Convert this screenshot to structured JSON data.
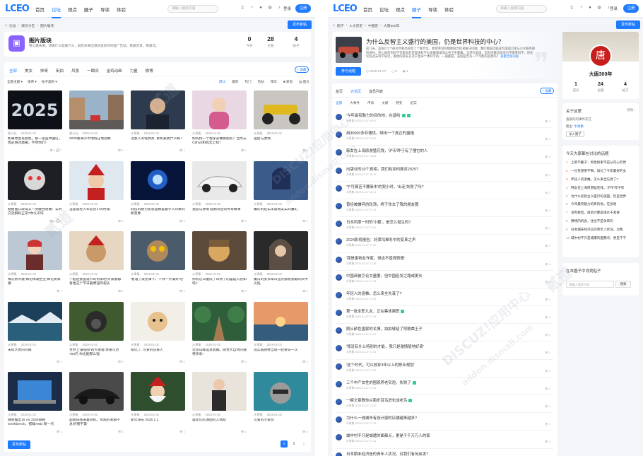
{
  "left": {
    "logo": "LCEO",
    "nav": [
      {
        "label": "首页",
        "active": false
      },
      {
        "label": "论坛",
        "active": true
      },
      {
        "label": "观点",
        "active": false
      },
      {
        "label": "圈子",
        "active": false
      },
      {
        "label": "导读",
        "active": false
      },
      {
        "label": "体验",
        "active": false
      }
    ],
    "search_placeholder": "请输入搜索内容",
    "login": "登录",
    "register": "注册",
    "breadcrumb": [
      "论坛",
      "演示分区",
      "图片版块"
    ],
    "new_post": "发布新帖",
    "forum": {
      "name": "图片版块",
      "desc": "用心赢未来。想做什么就做什么，鼓足未来出道就是你的地盘广告站，看最创意，看最流。",
      "stats": [
        {
          "value": "0",
          "label": "今日"
        },
        {
          "value": "28",
          "label": "主题"
        },
        {
          "value": "4",
          "label": "帖子"
        }
      ]
    },
    "tabs": [
      "全部",
      "美女",
      "帅哥",
      "街拍",
      "风景",
      "一瞬间",
      "金鸡动画",
      "力量",
      "微博"
    ],
    "collect": "+ 收藏",
    "filters": [
      "全部主题 ▾",
      "排序 ▾",
      "帖子类别 ▾"
    ],
    "sorts": [
      {
        "label": "默认",
        "active": true
      },
      {
        "label": "最新",
        "active": false
      },
      {
        "label": "热门",
        "active": false
      },
      {
        "label": "热帖",
        "active": false
      },
      {
        "label": "精华",
        "active": false
      },
      {
        "label": "■ 新窗",
        "active": false
      },
      {
        "label": "▤ 图文",
        "active": false
      }
    ],
    "gallery": [
      {
        "title": "如果你因有颜色，那一定是中国红，我必将对敲被，不然你们！",
        "author": "湘公社",
        "date": "2025-01-02",
        "stats": "👁 1  💬 1",
        "icon": "text-2025-dark"
      },
      {
        "title": "2025春海沙市地域在地观察",
        "author": "湘公社",
        "date": "2025-01-02",
        "stats": "👁 1",
        "icon": "city-street"
      },
      {
        "title": "注意人的经费高, 食和美我什么概？",
        "author": "水果集",
        "date": "2025-01-02",
        "stats": "👁 1",
        "icon": "man-portrait"
      },
      {
        "title": "如何找一个程序员做男朋友？当然去Github和码云上找！",
        "author": "水果集",
        "date": "2025-01-02",
        "stats": "👁 1",
        "icon": "woman-portrait"
      },
      {
        "title": "速度与激情",
        "author": "水果集",
        "date": "2025-01-02",
        "stats": "👁 1",
        "icon": "motorbike"
      },
      {
        "title": "骷髅面口取得又一突破性进展：实时交流解码正常?你认识吗",
        "author": "水果集",
        "date": "2025-01-02",
        "stats": "👁 1  💬 1",
        "icon": "skull-robot"
      },
      {
        "title": "当圣诞老人年纪历小的时候",
        "author": "水果集",
        "date": "2025-01-02",
        "stats": "👁 1",
        "icon": "santa-kid"
      },
      {
        "title": "科技的魅力总总是数是最令人印象的新景象",
        "author": "水果集",
        "date": "2025-01-02",
        "stats": "👁 1",
        "icon": "bulb-energy"
      },
      {
        "title": "速度与激情 超跑背后的传奇故事",
        "author": "水果集",
        "date": "2025-01-02",
        "stats": "👁 1",
        "icon": "sports-car"
      },
      {
        "title": "魔幻的纪实未容而实实的魔幻",
        "author": "水果集",
        "date": "2025-01-02",
        "stats": "👁 1",
        "icon": "anime-girl"
      },
      {
        "title": "梅花依大廈,梅花梅潮生业,梅花要离歌",
        "author": "水果集",
        "date": "2025-01-02",
        "stats": "👁 1",
        "icon": "winter-girl"
      },
      {
        "title": "一起迎接圣诞节的到来吧!大家都都有给这个节日最便道的祝乐",
        "author": "水果集",
        "date": "2025-01-02",
        "stats": "👁 1",
        "icon": "dog-santa"
      },
      {
        "title": "'看准了就把事干，干你一片美好'吧",
        "author": "水果集",
        "date": "2025-01-02",
        "stats": "👁 1",
        "icon": "owl-cat"
      },
      {
        "title": "你有这么酷炫了吗你了的猫是人族如吗?",
        "author": "水果集",
        "date": "2025-01-02",
        "stats": "👁 1",
        "icon": "cat-helmet"
      },
      {
        "title": "魔法的女孩早日显光都我我眼的风中火焰",
        "author": "水果集",
        "date": "2025-01-02",
        "stats": "👁 1",
        "icon": "hooded-girl"
      },
      {
        "title": "未似大觉的间候",
        "author": "水果集",
        "date": "2025-01-02",
        "stats": "👁 1",
        "icon": "lake-ice"
      },
      {
        "title": "世界上'最强悍'的大猩猩,体重可达700斤,你也能那么强",
        "author": "水果集",
        "date": "2025-01-02",
        "stats": "👁 1",
        "icon": "gorilla"
      },
      {
        "title": "萌化了, 可爱的狂暴人",
        "author": "水果集",
        "date": "2025-01-02",
        "stats": "👁 1",
        "icon": "puppy"
      },
      {
        "title": "近景山峰选景妩媚。感觉大自然的独特多彩!",
        "author": "水果集",
        "date": "2025-01-02",
        "stats": "👁 1",
        "icon": "forest-path"
      },
      {
        "title": "现实般感野当就一趁要去一次",
        "author": "水果集",
        "date": "2025-01-02",
        "stats": "👁 1",
        "icon": "lake-sunset"
      },
      {
        "title": "微星推出16 Air 2025规格 Geekbench，搭载AMD 新一代",
        "author": "水果集",
        "date": "2025-01-02",
        "stats": "👁 1",
        "icon": "laptop"
      },
      {
        "title": "超跑阵线来曼目标。零跑的底稿不总'好而不美'",
        "author": "水果集",
        "date": "2025-01-02",
        "stats": "👁 1",
        "icon": "black-car"
      },
      {
        "title": "新年快乐 2025 1.1",
        "author": "水果集",
        "date": "2025-01-02",
        "stats": "👁 1",
        "icon": "santa-old"
      },
      {
        "title": "美女们的演困的人情结",
        "author": "水果集",
        "date": "2025-01-02",
        "stats": "👁 1",
        "icon": "girl-coat"
      },
      {
        "title": "可爱的小家伙",
        "author": "水果集",
        "date": "2025-01-02",
        "stats": "👁 2",
        "icon": "raccoon"
      }
    ],
    "pager": [
      "1",
      "2",
      "›"
    ],
    "bottom_post": "发布新帖"
  },
  "right": {
    "logo": "LCEO",
    "nav": [
      {
        "label": "首页",
        "active": false
      },
      {
        "label": "论坛",
        "active": false
      },
      {
        "label": "观点",
        "active": false
      },
      {
        "label": "圈子",
        "active": true
      },
      {
        "label": "导读",
        "active": false
      },
      {
        "label": "体验",
        "active": false
      }
    ],
    "search_placeholder": "请输入搜索内容",
    "login": "登录",
    "register": "注册",
    "breadcrumb": [
      "圈子",
      "人文历史",
      "中国史",
      "大唐300年"
    ],
    "new_post": "发布新帖",
    "post": {
      "title": "为什么反智主义盛行的美国，仍是世界科技的中心？",
      "desc": "前几天，美国172个研究所和高校签了个联合信，希望参议院能能联合起来解决问题，我们能很迅猛成为美国卫生与公众服务部的部长，担心他的伪科学可能会危害美国科学与发展和美国公共卫生健康。当然在美国，因为宗教信仰成为不接受科学，进化论及过去科学研究，看他的部长在对于生命个体科学的，一般都是，美国是否有一个可能的答案吗？",
      "more": "查看全部内容",
      "join": "参与话题",
      "date": "2025-01-07",
      "replies": "0",
      "views": "1"
    },
    "list_tabs": [
      {
        "label": "首页",
        "active": false
      },
      {
        "label": "讨论区",
        "active": true
      },
      {
        "label": "成员列表",
        "active": false
      }
    ],
    "collect": "+ 收藏",
    "sub_tabs": [
      {
        "label": "全部",
        "active": true
      },
      {
        "label": "大事件",
        "active": false
      },
      {
        "label": "传承",
        "active": false
      },
      {
        "label": "文献",
        "active": false
      },
      {
        "label": "野史",
        "active": false
      },
      {
        "label": "纪实",
        "active": false
      }
    ],
    "threads": [
      {
        "title": "'今年最有魅力的目的地，在昌哈",
        "meta": "水果集  2025-01-07 18:57",
        "stats": "👁 2",
        "tags": [
          "#3c9",
          "#3c9"
        ]
      },
      {
        "title": "用35000多亚德供，绑出一个真正的露帽",
        "meta": "水果集  2025-01-07 18:40",
        "stats": "👁 1",
        "tags": []
      },
      {
        "title": "韩女在上海原游猛花钱，'沪币'昨于有了懂它的人",
        "meta": "水果集  2025-01-07 18:28",
        "stats": "👁 4",
        "tags": []
      },
      {
        "title": "出版业的10个真相，我们有如何面对2025?",
        "meta": "水果集  2025-01-07 18:12",
        "stats": "👁 1",
        "tags": []
      },
      {
        "title": "'宁可痛苦不要麻木'的契小时，'出走'失败了吗?",
        "meta": "水果集  2025-01-07 18:10",
        "stats": "👁 1",
        "tags": []
      },
      {
        "title": "曾经被嫌弃的轮滑，终于攻去了我的朋友圈",
        "meta": "水果集  2025-01-07 17:41",
        "stats": "👁 1",
        "tags": []
      },
      {
        "title": "日本风靡一时的'小额'，是怎么诞生的?",
        "meta": "水果集  2025-01-07 17:40",
        "stats": "👁 1",
        "tags": []
      },
      {
        "title": "2024影视报告：好莱坞难冬中的变革之声",
        "meta": "水果集  2025-01-07 17:37",
        "stats": "👁 1",
        "tags": []
      },
      {
        "title": "'我是废物女作家，但这不值得骄傲'",
        "meta": "水果集  2025-01-07 17:35",
        "stats": "👁 1",
        "tags": []
      },
      {
        "title": "中国商被引论文量第。但中国若发之路或更长",
        "meta": "水果集  2025-01-07 17:34",
        "stats": "👁 1",
        "tags": []
      },
      {
        "title": "年轻人的退帷。怎么来全先衰了?",
        "meta": "水果集  2025-01-07 17:30",
        "stats": "👁 1",
        "tags": []
      },
      {
        "title": "第一批全职儿女，正在集体离职",
        "meta": "水果集  2025-01-07 17:28",
        "stats": "👁 1",
        "tags": [
          "#3c9"
        ]
      },
      {
        "title": "刚从颜色国家的名博，拍拍够给了阿联酋王子",
        "meta": "水果集  2025-01-07 17:27",
        "stats": "👁 1",
        "tags": []
      },
      {
        "title": "'我没有什么特别的才能，我只是激情般地好奇'",
        "meta": "水果集  2025-01-07 17:26",
        "stats": "👁 1",
        "tags": []
      },
      {
        "title": "'这个时代，可以放弃3年以上的职业规划'",
        "meta": "水果集  2025-01-07 17:25",
        "stats": "👁 1",
        "tags": []
      },
      {
        "title": "三个中产女性的围观养老实验，失败了",
        "meta": "水果集  2025-01-07 17:22",
        "stats": "👁 1",
        "tags": [
          "#3c9"
        ]
      },
      {
        "title": "一瞬文章教你从跑步耳鸟进化成老鸟",
        "meta": "水果集  2025-01-07 17:20",
        "stats": "👁 1",
        "tags": [
          "#3c9"
        ]
      },
      {
        "title": "为什么一线城市有设计感的店铺越来越多?",
        "meta": "水果集  2025-01-07 17:16",
        "stats": "👁 1",
        "tags": []
      },
      {
        "title": "城中村不只是城遭的面都点，更是千千万万人的家",
        "meta": "水果集  2025-01-07 17:11",
        "stats": "👁 1",
        "tags": []
      },
      {
        "title": "日本期末经济信的青年人状况，对我们有何启发?",
        "meta": "水果集  2025-01-07 17:10",
        "stats": "👁 1",
        "tags": []
      }
    ],
    "profile": {
      "name": "大唐300年",
      "stats": [
        {
          "value": "1",
          "label": "成员"
        },
        {
          "value": "24",
          "label": "主题"
        },
        {
          "value": "4",
          "label": "帖子"
        }
      ]
    },
    "about": {
      "title": "关于这里",
      "edit": "修改 ›",
      "desc": "喜爱的的事件实在",
      "owner_label": "圈主:",
      "owner": "水果集",
      "join": "加入圈子"
    },
    "hot": {
      "title": "今天大家都在讨论的话题",
      "items": [
        "上即不戴子：男性如果不是从内心的觉",
        "一位性侵害学事。如比了今年最好的女",
        "年轻人的退帷。怎么来全先衰了?",
        "韩女在上海原游猛花钱，'沪币'昨于有",
        "为什么反智主义盛行的美国，仍是世界",
        "今年最有魅力的目的地，在昌哈",
        "没有教直，再努力都是纸水于紧要",
        "脾物的机会，往往不是争来的",
        "日本期末经济信的青年人状况，对我",
        "城中村不只是城遭的面都点，更是千千"
      ]
    },
    "search_box": {
      "title": "在本圈子中寻找贴子",
      "placeholder": "请输入搜索内容",
      "button": "搜索"
    }
  },
  "watermark": [
    "DISCUZ!应用中心",
    "addon.dismall.com",
    "贰道"
  ]
}
